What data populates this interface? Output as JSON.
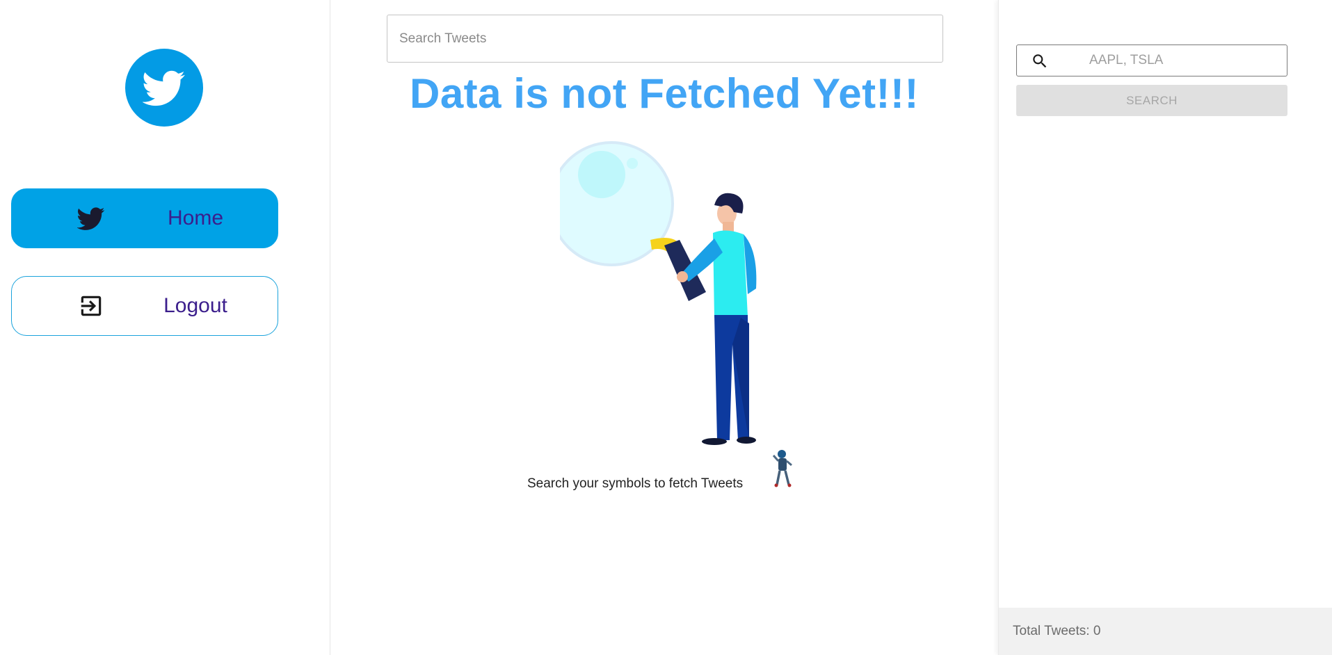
{
  "sidebar": {
    "logo_icon": "twitter-bird-icon",
    "items": [
      {
        "label": "Home",
        "icon": "twitter-bird-icon",
        "active": true
      },
      {
        "label": "Logout",
        "icon": "logout-icon",
        "active": false
      }
    ]
  },
  "main": {
    "search": {
      "placeholder": "Search Tweets",
      "value": ""
    },
    "headline": "Data is not Fetched Yet!!!",
    "hint": "Search your symbols to fetch Tweets",
    "illustration_icon": "man-with-magnifier-illustration"
  },
  "right_panel": {
    "symbol_search": {
      "placeholder": "AAPL, TSLA",
      "value": "",
      "icon": "search-icon"
    },
    "search_button_label": "SEARCH",
    "total_tweets_text": "Total Tweets: 0"
  },
  "colors": {
    "brand_blue": "#039be5",
    "home_button": "#00a2e6",
    "nav_text": "#3b1e8c",
    "headline": "#42a5f5",
    "disabled_button": "#e0e0e0"
  }
}
